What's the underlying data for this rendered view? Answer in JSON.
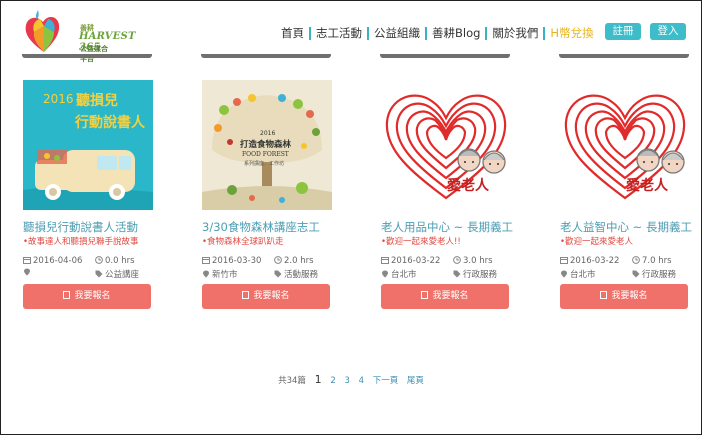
{
  "logo": {
    "small": "善耕",
    "brand": "HARVEST 365",
    "sub": "公益媒合平台"
  },
  "nav": [
    {
      "label": "首頁"
    },
    {
      "label": "志工活動"
    },
    {
      "label": "公益組織"
    },
    {
      "label": "善耕Blog"
    },
    {
      "label": "關於我們"
    },
    {
      "label": "H幣兌換"
    }
  ],
  "auth": {
    "register": "註冊",
    "login": "登入"
  },
  "cards": [
    {
      "title": "聽損兒行動說書人活動",
      "subtitle": "•故事達人和聽損兒聯手說故事",
      "date": "2016-04-06",
      "hours": "0.0 hrs",
      "location": "",
      "category": "公益講座",
      "button": "我要報名",
      "thumb": {
        "year": "2016",
        "line1": "聽損兒",
        "line2": "行動說書人"
      }
    },
    {
      "title": "3/30食物森林講座志工",
      "subtitle": "•食物森林全球趴趴走",
      "date": "2016-03-30",
      "hours": "2.0 hrs",
      "location": "新竹市",
      "category": "活動服務",
      "button": "我要報名",
      "thumb": {
        "year": "2016",
        "line1": "打造食物森林",
        "line2": "FOOD FOREST",
        "line3": "系列講座．工作坊"
      }
    },
    {
      "title": "老人用品中心 ~ 長期義工",
      "subtitle": "•歡迎一起來愛老人!!",
      "date": "2016-03-22",
      "hours": "3.0 hrs",
      "location": "台北市",
      "category": "行政服務",
      "button": "我要報名",
      "thumb": {
        "caption": "愛老人"
      }
    },
    {
      "title": "老人益智中心 ~ 長期義工",
      "subtitle": "•歡迎一起來愛老人",
      "date": "2016-03-22",
      "hours": "7.0 hrs",
      "location": "台北市",
      "category": "行政服務",
      "button": "我要報名",
      "thumb": {
        "caption": "愛老人"
      }
    }
  ],
  "pager": {
    "total": "共34篇",
    "current": "1",
    "pages": [
      "2",
      "3",
      "4"
    ],
    "next": "下一頁",
    "last": "尾頁"
  },
  "colors": {
    "accent": "#3dbcc9",
    "button": "#f0706a",
    "title": "#4c9db3",
    "subtitle": "#e0483f",
    "hcoin": "#e6b421"
  }
}
